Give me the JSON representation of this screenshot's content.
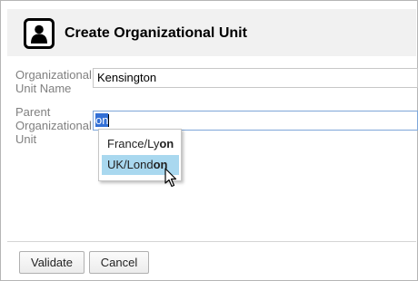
{
  "dialog": {
    "title": "Create Organizational Unit",
    "header_icon": "user-icon"
  },
  "form": {
    "ou_name": {
      "label": "Organizational Unit Name",
      "value": "Kensington"
    },
    "parent_ou": {
      "label": "Parent Organizational Unit",
      "value": "on"
    }
  },
  "autocomplete": {
    "items": [
      {
        "prefix": "France/Ly",
        "match": "on",
        "suffix": "",
        "selected": false
      },
      {
        "prefix": "UK/Lond",
        "match": "on",
        "suffix": "",
        "selected": true
      }
    ]
  },
  "buttons": {
    "validate": "Validate",
    "cancel": "Cancel"
  },
  "colors": {
    "header_bg": "#f1f1f1",
    "selected_item_bg": "#a9d8ef",
    "text_selection": "#3370d6",
    "label_color": "#808080"
  }
}
